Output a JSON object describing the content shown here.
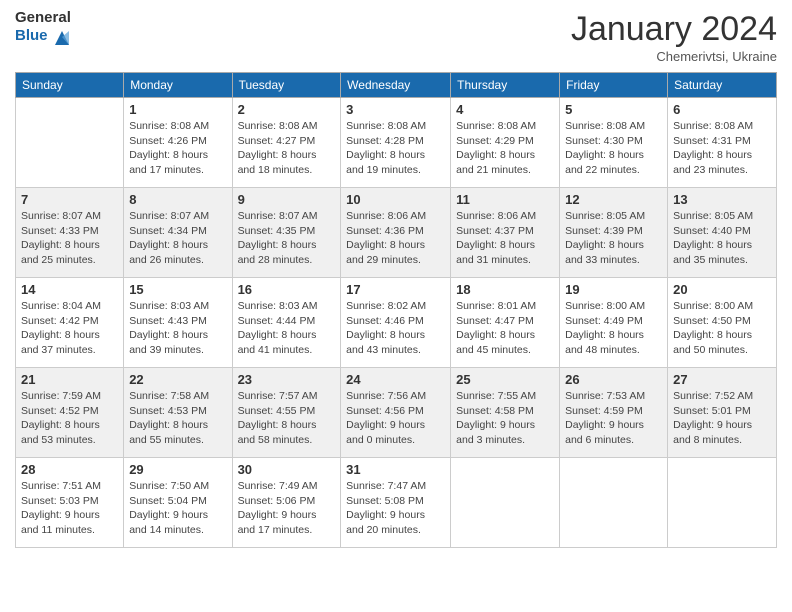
{
  "header": {
    "logo_general": "General",
    "logo_blue": "Blue",
    "title": "January 2024",
    "subtitle": "Chemerivtsi, Ukraine"
  },
  "calendar": {
    "days_of_week": [
      "Sunday",
      "Monday",
      "Tuesday",
      "Wednesday",
      "Thursday",
      "Friday",
      "Saturday"
    ],
    "weeks": [
      [
        {
          "day": "",
          "sunrise": "",
          "sunset": "",
          "daylight": ""
        },
        {
          "day": "1",
          "sunrise": "Sunrise: 8:08 AM",
          "sunset": "Sunset: 4:26 PM",
          "daylight": "Daylight: 8 hours and 17 minutes."
        },
        {
          "day": "2",
          "sunrise": "Sunrise: 8:08 AM",
          "sunset": "Sunset: 4:27 PM",
          "daylight": "Daylight: 8 hours and 18 minutes."
        },
        {
          "day": "3",
          "sunrise": "Sunrise: 8:08 AM",
          "sunset": "Sunset: 4:28 PM",
          "daylight": "Daylight: 8 hours and 19 minutes."
        },
        {
          "day": "4",
          "sunrise": "Sunrise: 8:08 AM",
          "sunset": "Sunset: 4:29 PM",
          "daylight": "Daylight: 8 hours and 21 minutes."
        },
        {
          "day": "5",
          "sunrise": "Sunrise: 8:08 AM",
          "sunset": "Sunset: 4:30 PM",
          "daylight": "Daylight: 8 hours and 22 minutes."
        },
        {
          "day": "6",
          "sunrise": "Sunrise: 8:08 AM",
          "sunset": "Sunset: 4:31 PM",
          "daylight": "Daylight: 8 hours and 23 minutes."
        }
      ],
      [
        {
          "day": "7",
          "sunrise": "Sunrise: 8:07 AM",
          "sunset": "Sunset: 4:33 PM",
          "daylight": "Daylight: 8 hours and 25 minutes."
        },
        {
          "day": "8",
          "sunrise": "Sunrise: 8:07 AM",
          "sunset": "Sunset: 4:34 PM",
          "daylight": "Daylight: 8 hours and 26 minutes."
        },
        {
          "day": "9",
          "sunrise": "Sunrise: 8:07 AM",
          "sunset": "Sunset: 4:35 PM",
          "daylight": "Daylight: 8 hours and 28 minutes."
        },
        {
          "day": "10",
          "sunrise": "Sunrise: 8:06 AM",
          "sunset": "Sunset: 4:36 PM",
          "daylight": "Daylight: 8 hours and 29 minutes."
        },
        {
          "day": "11",
          "sunrise": "Sunrise: 8:06 AM",
          "sunset": "Sunset: 4:37 PM",
          "daylight": "Daylight: 8 hours and 31 minutes."
        },
        {
          "day": "12",
          "sunrise": "Sunrise: 8:05 AM",
          "sunset": "Sunset: 4:39 PM",
          "daylight": "Daylight: 8 hours and 33 minutes."
        },
        {
          "day": "13",
          "sunrise": "Sunrise: 8:05 AM",
          "sunset": "Sunset: 4:40 PM",
          "daylight": "Daylight: 8 hours and 35 minutes."
        }
      ],
      [
        {
          "day": "14",
          "sunrise": "Sunrise: 8:04 AM",
          "sunset": "Sunset: 4:42 PM",
          "daylight": "Daylight: 8 hours and 37 minutes."
        },
        {
          "day": "15",
          "sunrise": "Sunrise: 8:03 AM",
          "sunset": "Sunset: 4:43 PM",
          "daylight": "Daylight: 8 hours and 39 minutes."
        },
        {
          "day": "16",
          "sunrise": "Sunrise: 8:03 AM",
          "sunset": "Sunset: 4:44 PM",
          "daylight": "Daylight: 8 hours and 41 minutes."
        },
        {
          "day": "17",
          "sunrise": "Sunrise: 8:02 AM",
          "sunset": "Sunset: 4:46 PM",
          "daylight": "Daylight: 8 hours and 43 minutes."
        },
        {
          "day": "18",
          "sunrise": "Sunrise: 8:01 AM",
          "sunset": "Sunset: 4:47 PM",
          "daylight": "Daylight: 8 hours and 45 minutes."
        },
        {
          "day": "19",
          "sunrise": "Sunrise: 8:00 AM",
          "sunset": "Sunset: 4:49 PM",
          "daylight": "Daylight: 8 hours and 48 minutes."
        },
        {
          "day": "20",
          "sunrise": "Sunrise: 8:00 AM",
          "sunset": "Sunset: 4:50 PM",
          "daylight": "Daylight: 8 hours and 50 minutes."
        }
      ],
      [
        {
          "day": "21",
          "sunrise": "Sunrise: 7:59 AM",
          "sunset": "Sunset: 4:52 PM",
          "daylight": "Daylight: 8 hours and 53 minutes."
        },
        {
          "day": "22",
          "sunrise": "Sunrise: 7:58 AM",
          "sunset": "Sunset: 4:53 PM",
          "daylight": "Daylight: 8 hours and 55 minutes."
        },
        {
          "day": "23",
          "sunrise": "Sunrise: 7:57 AM",
          "sunset": "Sunset: 4:55 PM",
          "daylight": "Daylight: 8 hours and 58 minutes."
        },
        {
          "day": "24",
          "sunrise": "Sunrise: 7:56 AM",
          "sunset": "Sunset: 4:56 PM",
          "daylight": "Daylight: 9 hours and 0 minutes."
        },
        {
          "day": "25",
          "sunrise": "Sunrise: 7:55 AM",
          "sunset": "Sunset: 4:58 PM",
          "daylight": "Daylight: 9 hours and 3 minutes."
        },
        {
          "day": "26",
          "sunrise": "Sunrise: 7:53 AM",
          "sunset": "Sunset: 4:59 PM",
          "daylight": "Daylight: 9 hours and 6 minutes."
        },
        {
          "day": "27",
          "sunrise": "Sunrise: 7:52 AM",
          "sunset": "Sunset: 5:01 PM",
          "daylight": "Daylight: 9 hours and 8 minutes."
        }
      ],
      [
        {
          "day": "28",
          "sunrise": "Sunrise: 7:51 AM",
          "sunset": "Sunset: 5:03 PM",
          "daylight": "Daylight: 9 hours and 11 minutes."
        },
        {
          "day": "29",
          "sunrise": "Sunrise: 7:50 AM",
          "sunset": "Sunset: 5:04 PM",
          "daylight": "Daylight: 9 hours and 14 minutes."
        },
        {
          "day": "30",
          "sunrise": "Sunrise: 7:49 AM",
          "sunset": "Sunset: 5:06 PM",
          "daylight": "Daylight: 9 hours and 17 minutes."
        },
        {
          "day": "31",
          "sunrise": "Sunrise: 7:47 AM",
          "sunset": "Sunset: 5:08 PM",
          "daylight": "Daylight: 9 hours and 20 minutes."
        },
        {
          "day": "",
          "sunrise": "",
          "sunset": "",
          "daylight": ""
        },
        {
          "day": "",
          "sunrise": "",
          "sunset": "",
          "daylight": ""
        },
        {
          "day": "",
          "sunrise": "",
          "sunset": "",
          "daylight": ""
        }
      ]
    ]
  }
}
